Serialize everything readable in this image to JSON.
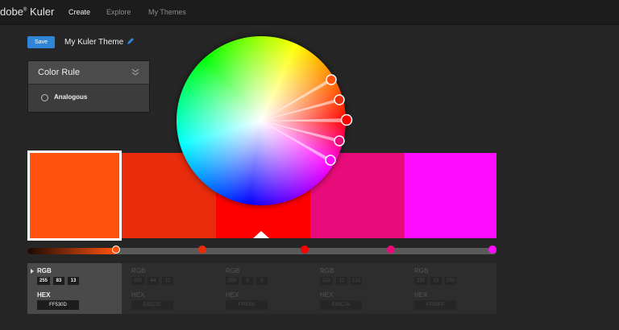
{
  "app": {
    "logo_text": "dobe",
    "logo_reg": "®",
    "logo_product": " Kuler"
  },
  "nav": [
    {
      "label": "Create",
      "active": true
    },
    {
      "label": "Explore",
      "active": false
    },
    {
      "label": "My Themes",
      "active": false
    }
  ],
  "toolbar": {
    "save_label": "Save",
    "theme_name": "My Kuler Theme"
  },
  "color_rule": {
    "title": "Color Rule",
    "selected": "Analogous"
  },
  "colors": {
    "swatches": [
      "#FF530D",
      "#E82C0C",
      "#FF0000",
      "#E80C7A",
      "#FF0DFF"
    ],
    "selected_index": 0,
    "accent": "#2f86d6"
  },
  "values": [
    {
      "rgb_label": "RGB",
      "r": "255",
      "g": "83",
      "b": "13",
      "hex_label": "HEX",
      "hex": "FF530D"
    },
    {
      "rgb_label": "RGB",
      "r": "232",
      "g": "44",
      "b": "12",
      "hex_label": "HEX",
      "hex": "E82C0C"
    },
    {
      "rgb_label": "RGB",
      "r": "255",
      "g": "0",
      "b": "0",
      "hex_label": "HEX",
      "hex": "FF0000"
    },
    {
      "rgb_label": "RGB",
      "r": "232",
      "g": "12",
      "b": "122",
      "hex_label": "HEX",
      "hex": "E80C7A"
    },
    {
      "rgb_label": "RGB",
      "r": "255",
      "g": "13",
      "b": "255",
      "hex_label": "HEX",
      "hex": "FF0DFF"
    }
  ]
}
